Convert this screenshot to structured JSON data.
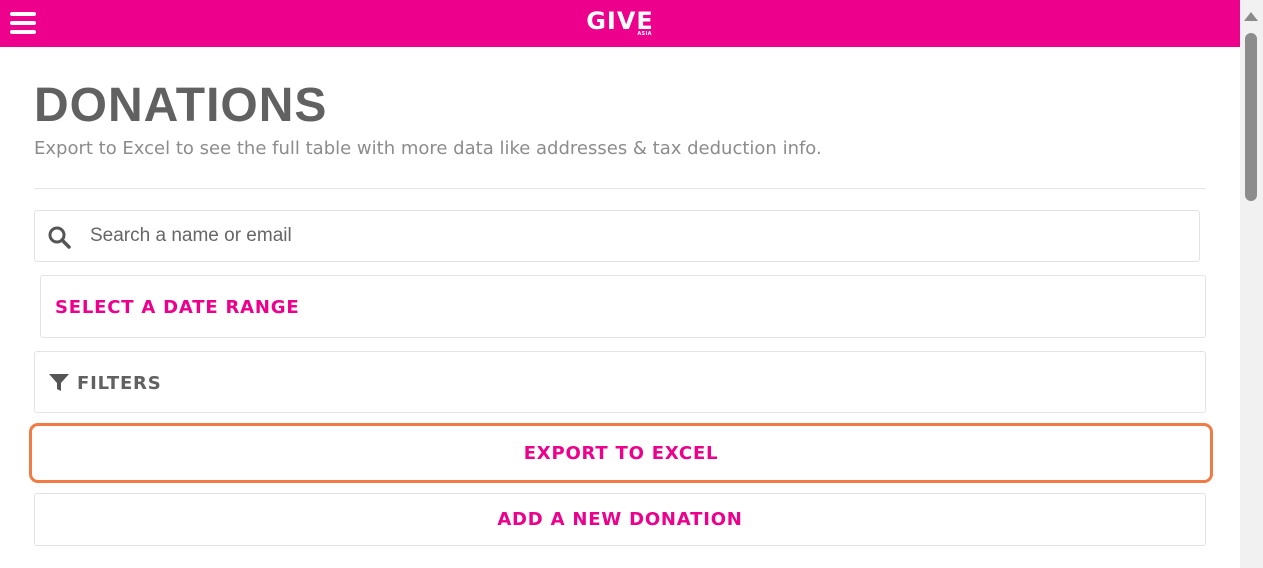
{
  "header": {
    "logo_main": "GIVE",
    "logo_sub": "ASIA",
    "background_color": "#ec008c"
  },
  "page": {
    "title": "DONATIONS",
    "subtitle": "Export to Excel to see the full table with more data like addresses & tax deduction info."
  },
  "search": {
    "placeholder": "Search a name or email",
    "value": ""
  },
  "date_range": {
    "label": "SELECT A DATE RANGE"
  },
  "filters": {
    "label": "FILTERS"
  },
  "actions": {
    "export_label": "EXPORT TO EXCEL",
    "add_label": "ADD A NEW DONATION"
  },
  "colors": {
    "brand": "#ec008c",
    "focus_outline": "#f27b45",
    "title_text": "#616161"
  },
  "icons": {
    "menu": "hamburger-menu-icon",
    "search": "search-icon",
    "filter": "filter-funnel-icon"
  }
}
